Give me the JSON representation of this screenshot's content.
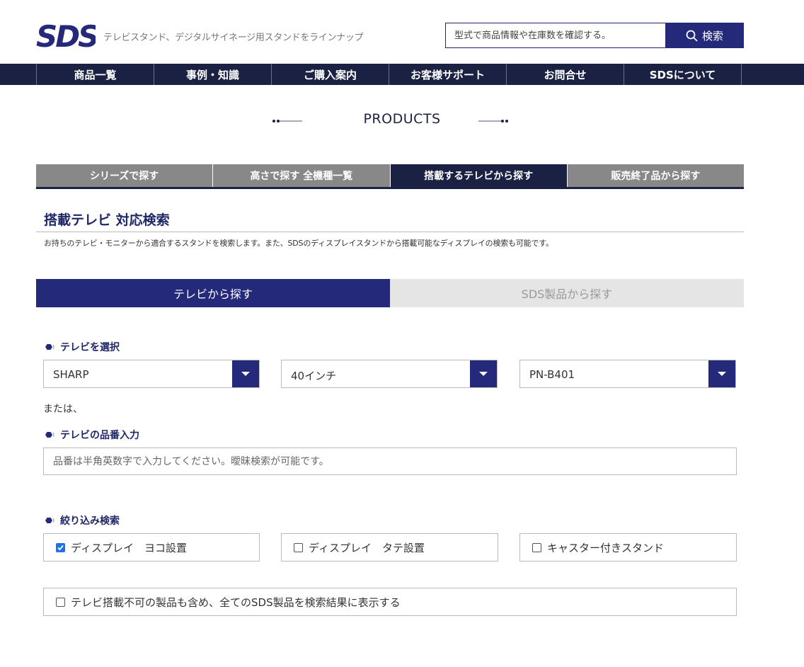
{
  "header": {
    "logo_text": "SDS",
    "tagline": "テレビスタンド、デジタルサイネージ用スタンドをラインナップ",
    "search_placeholder": "型式で商品情報や在庫数を確認する。",
    "search_button": "検索"
  },
  "nav": {
    "items": [
      "商品一覧",
      "事例・知識",
      "ご購入案内",
      "お客様サポート",
      "お問合せ",
      "SDSについて"
    ]
  },
  "section_title": "PRODUCTS",
  "category_tabs": [
    {
      "label": "シリーズで探す",
      "active": false
    },
    {
      "label": "高さで探す 全機種一覧",
      "active": false
    },
    {
      "label": "搭載するテレビから探す",
      "active": true
    },
    {
      "label": "販売終了品から探す",
      "active": false
    }
  ],
  "page": {
    "heading": "搭載テレビ 対応検索",
    "description": "お持ちのテレビ・モニターから適合するスタンドを検索します。また、SDSのディスプレイスタンドから搭載可能なディスプレイの検索も可能です。"
  },
  "mode_tabs": [
    {
      "label": "テレビから探す",
      "active": true
    },
    {
      "label": "SDS製品から探す",
      "active": false
    }
  ],
  "tv_select": {
    "label": "テレビを選択",
    "maker": "SHARP",
    "size": "40インチ",
    "model": "PN-B401"
  },
  "or_text": "または、",
  "model_input": {
    "label": "テレビの品番入力",
    "placeholder": "品番は半角英数字で入力してください。曖昧検索が可能です。"
  },
  "filter": {
    "label": "絞り込み検索",
    "options": [
      {
        "label": "ディスプレイ　ヨコ設置",
        "checked": true
      },
      {
        "label": "ディスプレイ　タテ設置",
        "checked": false
      },
      {
        "label": "キャスター付きスタンド",
        "checked": false
      }
    ],
    "include_all": {
      "label": "テレビ搭載不可の製品も含め、全てのSDS製品を検索結果に表示する",
      "checked": false
    }
  },
  "colors": {
    "navy": "#1a2143",
    "accent": "#24297a",
    "tab_gray": "#888888",
    "checkbox_blue": "#1a73e8"
  }
}
